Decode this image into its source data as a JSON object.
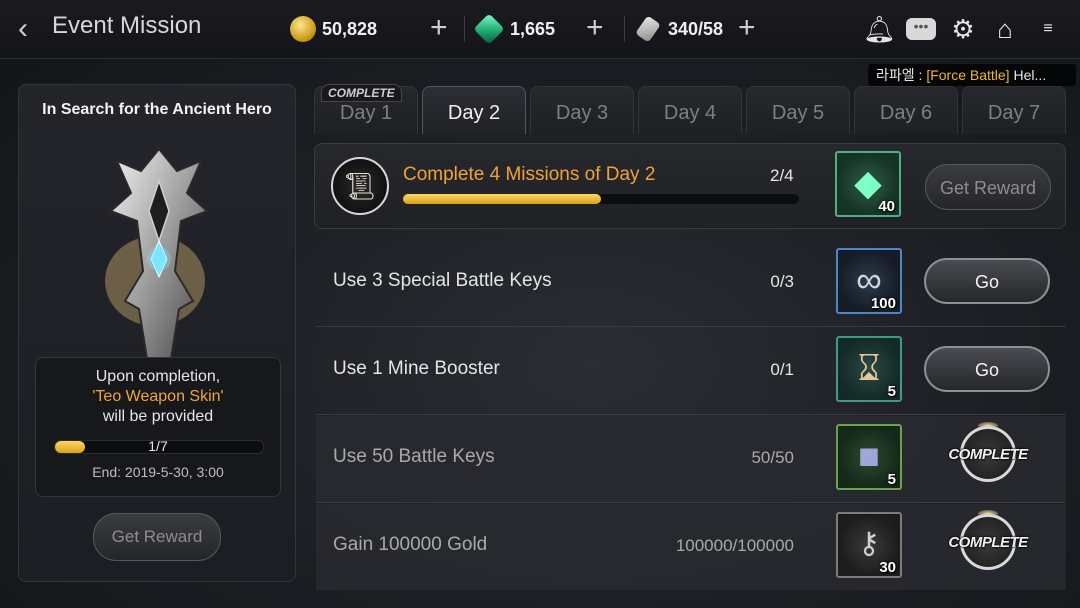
{
  "header": {
    "title": "Event Mission",
    "gold": "50,828",
    "gems": "1,665",
    "keys": "340/58",
    "notice_prefix": "라파엘 : ",
    "notice_highlight": "[Force Battle]",
    "notice_suffix": " Hel..."
  },
  "left_panel": {
    "title": "In Search for the Ancient Hero",
    "line1": "Upon completion,",
    "line2": "'Teo Weapon Skin'",
    "line3": "will be provided",
    "progress_text": "1/7",
    "progress_fraction": 0.143,
    "end_text": "End: 2019-5-30, 3:00",
    "button_label": "Get Reward"
  },
  "tabs": [
    {
      "label": "Day 1",
      "badge": "COMPLETE"
    },
    {
      "label": "Day 2",
      "active": true
    },
    {
      "label": "Day 3"
    },
    {
      "label": "Day 4"
    },
    {
      "label": "Day 5"
    },
    {
      "label": "Day 6"
    },
    {
      "label": "Day 7"
    }
  ],
  "main_mission": {
    "label": "Complete 4 Missions of Day 2",
    "count": "2/4",
    "progress_fraction": 0.5,
    "reward_qty": "40",
    "button_label": "Get Reward"
  },
  "missions": [
    {
      "label": "Use 3 Special Battle Keys",
      "count": "0/3",
      "reward_icon": "infinity-key-icon",
      "reward_qty": "100",
      "action": "Go"
    },
    {
      "label": "Use 1 Mine Booster",
      "count": "0/1",
      "reward_icon": "hourglass-icon",
      "reward_qty": "5",
      "action": "Go"
    },
    {
      "label": "Use 50 Battle Keys",
      "count": "50/50",
      "reward_icon": "book-icon",
      "reward_qty": "5",
      "action": "COMPLETE"
    },
    {
      "label": "Gain 100000 Gold",
      "count": "100000/100000",
      "reward_icon": "key-icon",
      "reward_qty": "30",
      "action": "COMPLETE"
    }
  ],
  "colors": {
    "accent_orange": "#f0a23a",
    "progress_yellow": "#ffd764"
  }
}
